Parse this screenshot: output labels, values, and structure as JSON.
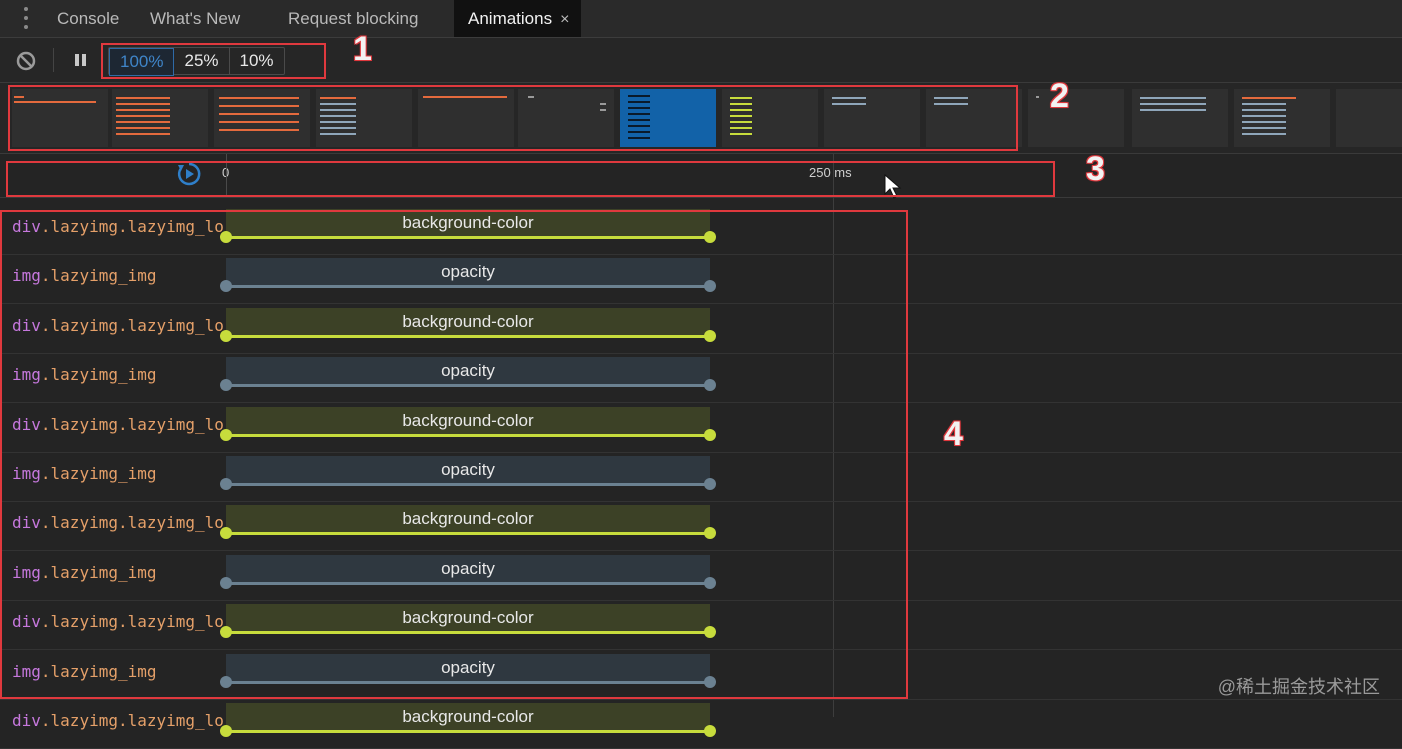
{
  "tabs": [
    {
      "label": "Console"
    },
    {
      "label": "What's New"
    },
    {
      "label": "Request blocking"
    },
    {
      "label": "Animations",
      "close": "×"
    }
  ],
  "toolbar": {
    "speeds": [
      "100%",
      "25%",
      "10%"
    ],
    "selected_speed": "100%"
  },
  "timeline": {
    "ticks": [
      "0",
      "250 ms"
    ]
  },
  "rows": [
    {
      "tag": "div",
      "cls": ".lazyimg.lazyimg_lo",
      "property": "background-color"
    },
    {
      "tag": "img",
      "cls": ".lazyimg_img",
      "property": "opacity"
    },
    {
      "tag": "div",
      "cls": ".lazyimg.lazyimg_lo",
      "property": "background-color"
    },
    {
      "tag": "img",
      "cls": ".lazyimg_img",
      "property": "opacity"
    },
    {
      "tag": "div",
      "cls": ".lazyimg.lazyimg_lo",
      "property": "background-color"
    },
    {
      "tag": "img",
      "cls": ".lazyimg_img",
      "property": "opacity"
    },
    {
      "tag": "div",
      "cls": ".lazyimg.lazyimg_lo",
      "property": "background-color"
    },
    {
      "tag": "img",
      "cls": ".lazyimg_img",
      "property": "opacity"
    },
    {
      "tag": "div",
      "cls": ".lazyimg.lazyimg_lo",
      "property": "background-color"
    },
    {
      "tag": "img",
      "cls": ".lazyimg_img",
      "property": "opacity"
    },
    {
      "tag": "div",
      "cls": ".lazyimg.lazyimg_lo",
      "property": "background-color"
    }
  ],
  "annotations": [
    "1",
    "2",
    "3",
    "4"
  ],
  "watermark": "@稀土掘金技术社区",
  "colors": {
    "background_color_track": "#c7dc3c",
    "opacity_track": "#6b8191",
    "selected_speed": "#3f85c9",
    "annotation_red": "#e0393e"
  },
  "icons": [
    "more-vertical-icon",
    "clear-block-icon",
    "pause-icon",
    "replay-icon",
    "close-icon",
    "mouse-cursor-icon"
  ]
}
